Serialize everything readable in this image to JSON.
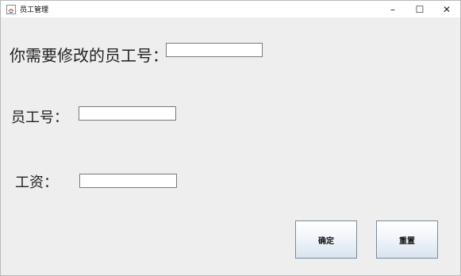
{
  "window": {
    "title": "员工管理",
    "controls": {
      "minimize": "–",
      "maximize": "☐",
      "close": "✕"
    }
  },
  "form": {
    "modify_id_label": "你需要修改的员工号：",
    "modify_id_value": "",
    "employee_id_label": "员工号：",
    "employee_id_value": "",
    "salary_label": "工资：",
    "salary_value": ""
  },
  "buttons": {
    "confirm": "确定",
    "reset": "重置"
  },
  "colors": {
    "background": "#eeeeee",
    "titlebar": "#ffffff",
    "button_gradient_bottom": "#d9e4ef"
  }
}
